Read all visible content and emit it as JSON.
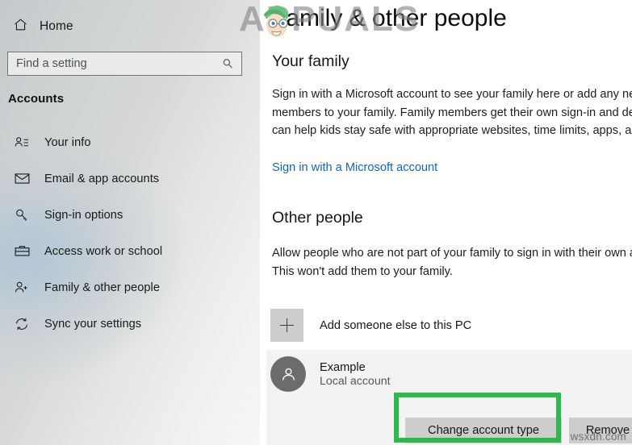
{
  "sidebar": {
    "home": {
      "label": "Home",
      "icon": "home-icon"
    },
    "search": {
      "placeholder": "Find a setting",
      "icon": "search-icon"
    },
    "section_heading": "Accounts",
    "items": [
      {
        "label": "Your info",
        "icon": "user-info-icon"
      },
      {
        "label": "Email & app accounts",
        "icon": "mail-icon"
      },
      {
        "label": "Sign-in options",
        "icon": "key-icon"
      },
      {
        "label": "Access work or school",
        "icon": "briefcase-icon"
      },
      {
        "label": "Family & other people",
        "icon": "user-add-icon"
      },
      {
        "label": "Sync your settings",
        "icon": "sync-icon"
      }
    ]
  },
  "main": {
    "title": "Family & other people",
    "your_family": {
      "heading": "Your family",
      "body": "Sign in with a Microsoft account to see your family here or add any new members to your family. Family members get their own sign-in and desktop. You can help kids stay safe with appropriate websites, time limits, apps, and games.",
      "link": "Sign in with a Microsoft account"
    },
    "other_people": {
      "heading": "Other people",
      "body": "Allow people who are not part of your family to sign in with their own accounts. This won't add them to your family.",
      "add_label": "Add someone else to this PC",
      "add_icon": "plus-icon"
    },
    "account": {
      "name": "Example",
      "type": "Local account",
      "avatar_icon": "person-avatar-icon",
      "change_button": "Change account type",
      "remove_button": "Remove"
    }
  },
  "watermarks": {
    "brand": "APPUALS",
    "site": "wsxdn.com"
  },
  "colors": {
    "highlight_green": "#2fb84f",
    "link_blue": "#1667b3",
    "button_gray": "#cdcdcd",
    "avatar_gray": "#6c6c6c"
  }
}
